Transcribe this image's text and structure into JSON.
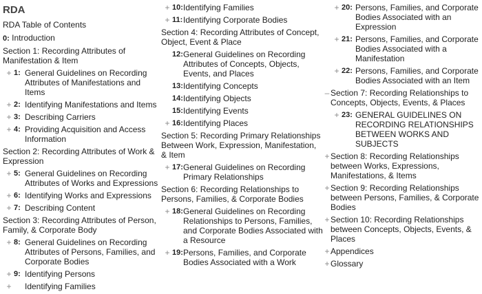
{
  "app_title": "RDA",
  "toc_title": "RDA Table of Contents",
  "colors": {
    "text": "#222222",
    "toggle": "#888888",
    "title": "#444444"
  },
  "col1": [
    {
      "kind": "intro",
      "num": "0:",
      "label": "Introduction"
    },
    {
      "kind": "section",
      "toggle": "",
      "label": "Section 1: Recording Attributes of Manifestation & Item"
    },
    {
      "kind": "chapter",
      "toggle": "+",
      "num": "1:",
      "label": "General Guidelines on Recording Attributes of Manifestations and Items"
    },
    {
      "kind": "chapter",
      "toggle": "+",
      "num": "2:",
      "label": "Identifying Manifestations and Items"
    },
    {
      "kind": "chapter",
      "toggle": "+",
      "num": "3:",
      "label": "Describing Carriers"
    },
    {
      "kind": "chapter",
      "toggle": "+",
      "num": "4:",
      "label": "Providing Acquisition and Access Information"
    },
    {
      "kind": "section",
      "toggle": "",
      "label": "Section 2: Recording Attributes of Work & Expression"
    },
    {
      "kind": "chapter",
      "toggle": "+",
      "num": "5:",
      "label": "General Guidelines on Recording Attributes of Works and Expressions"
    },
    {
      "kind": "chapter",
      "toggle": "+",
      "num": "6:",
      "label": "Identifying Works and Expressions"
    },
    {
      "kind": "chapter",
      "toggle": "+",
      "num": "7:",
      "label": "Describing Content"
    },
    {
      "kind": "section",
      "toggle": "",
      "label": "Section 3: Recording Attributes of Person, Family, & Corporate Body"
    },
    {
      "kind": "chapter",
      "toggle": "+",
      "num": "8:",
      "label": "General Guidelines on Recording Attributes of Persons, Families, and Corporate Bodies"
    },
    {
      "kind": "chapter",
      "toggle": "+",
      "num": "9:",
      "label": "Identifying Persons"
    },
    {
      "kind": "chapter",
      "toggle": "+",
      "num": "",
      "label": "Identifying Families"
    }
  ],
  "col2": [
    {
      "kind": "chapter",
      "toggle": "+",
      "num": "10:",
      "label": "Identifying Families"
    },
    {
      "kind": "chapter",
      "toggle": "+",
      "num": "11:",
      "label": "Identifying Corporate Bodies"
    },
    {
      "kind": "section",
      "toggle": "",
      "label": "Section 4: Recording Attributes of Concept, Object, Event & Place"
    },
    {
      "kind": "chapter",
      "toggle": "",
      "num": "12:",
      "label": "General Guidelines on Recording Attributes of Concepts, Objects, Events, and Places"
    },
    {
      "kind": "chapter",
      "toggle": "",
      "num": "13:",
      "label": "Identifying Concepts"
    },
    {
      "kind": "chapter",
      "toggle": "",
      "num": "14:",
      "label": "Identifying Objects"
    },
    {
      "kind": "chapter",
      "toggle": "",
      "num": "15:",
      "label": "Identifying Events"
    },
    {
      "kind": "chapter",
      "toggle": "+",
      "num": "16:",
      "label": "Identifying Places"
    },
    {
      "kind": "section",
      "toggle": "",
      "label": "Section 5: Recording Primary Relationships Between Work, Expression, Manifestation, & Item"
    },
    {
      "kind": "chapter",
      "toggle": "+",
      "num": "17:",
      "label": "General Guidelines on Recording Primary Relationships"
    },
    {
      "kind": "section",
      "toggle": "",
      "label": "Section 6: Recording Relationships to Persons, Families, & Corporate Bodies"
    },
    {
      "kind": "chapter",
      "toggle": "+",
      "num": "18:",
      "label": "General Guidelines on Recording Relationships to Persons, Families, and Corporate Bodies Associated with a Resource"
    },
    {
      "kind": "chapter",
      "toggle": "+",
      "num": "19:",
      "label": "Persons, Families, and Corporate Bodies Associated with a Work"
    }
  ],
  "col3": [
    {
      "kind": "chapter",
      "toggle": "+",
      "num": "20:",
      "label": "Persons, Families, and Corporate Bodies Associated with an Expression"
    },
    {
      "kind": "chapter",
      "toggle": "+",
      "num": "21:",
      "label": "Persons, Families, and Corporate Bodies Associated with a Manifestation"
    },
    {
      "kind": "chapter",
      "toggle": "+",
      "num": "22:",
      "label": "Persons, Families, and Corporate Bodies Associated with an Item"
    },
    {
      "kind": "section",
      "toggle": "–",
      "label": "Section 7: Recording Relationships to Concepts, Objects, Events, & Places"
    },
    {
      "kind": "chapter",
      "toggle": "+",
      "num": "23:",
      "label": "GENERAL GUIDELINES ON RECORDING RELATIONSHIPS BETWEEN WORKS AND SUBJECTS"
    },
    {
      "kind": "section",
      "toggle": "+",
      "label": "Section 8: Recording Relationships between Works, Expressions, Manifestations, & Items"
    },
    {
      "kind": "section",
      "toggle": "+",
      "label": "Section 9: Recording Relationships between Persons, Families, & Corporate Bodies"
    },
    {
      "kind": "section",
      "toggle": "+",
      "label": "Section 10: Recording Relationships between Concepts, Objects, Events, & Places"
    },
    {
      "kind": "section",
      "toggle": "+",
      "label": "Appendices"
    },
    {
      "kind": "section",
      "toggle": "+",
      "label": "Glossary"
    }
  ]
}
